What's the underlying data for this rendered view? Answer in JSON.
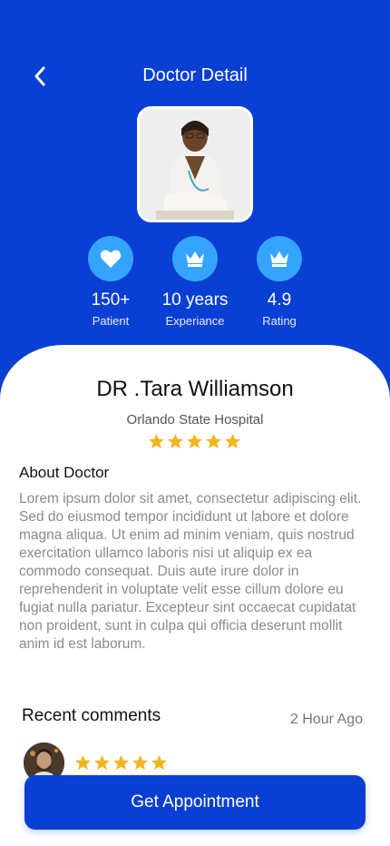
{
  "header": {
    "title": "Doctor Detail"
  },
  "stats": [
    {
      "icon": "heart-icon",
      "value": "150+",
      "label": "Patient"
    },
    {
      "icon": "crown-icon",
      "value": "10 years",
      "label": "Experiance"
    },
    {
      "icon": "crown-icon",
      "value": "4.9",
      "label": "Rating"
    }
  ],
  "doctor": {
    "name": "DR .Tara Williamson",
    "hospital": "Orlando State Hospital",
    "stars": 5
  },
  "about": {
    "title": "About Doctor",
    "text": "Lorem ipsum dolor sit amet, consectetur adipiscing elit. Sed do eiusmod tempor incididunt ut labore et dolore magna aliqua. Ut enim ad minim veniam, quis nostrud exercitation ullamco laboris nisi ut aliquip ex ea commodo consequat. Duis aute irure dolor in reprehenderit in voluptate velit esse cillum dolore eu fugiat nulla pariatur. Excepteur sint occaecat cupidatat non proident, sunt in culpa qui officia deserunt mollit anim id est laborum."
  },
  "comments": {
    "title": "Recent comments",
    "time": "2 Hour Ago",
    "stars": 5
  },
  "cta": {
    "label": "Get Appointment"
  },
  "colors": {
    "primary": "#0a3fd4",
    "accent": "#35a4ff",
    "star": "#f2b51c"
  }
}
